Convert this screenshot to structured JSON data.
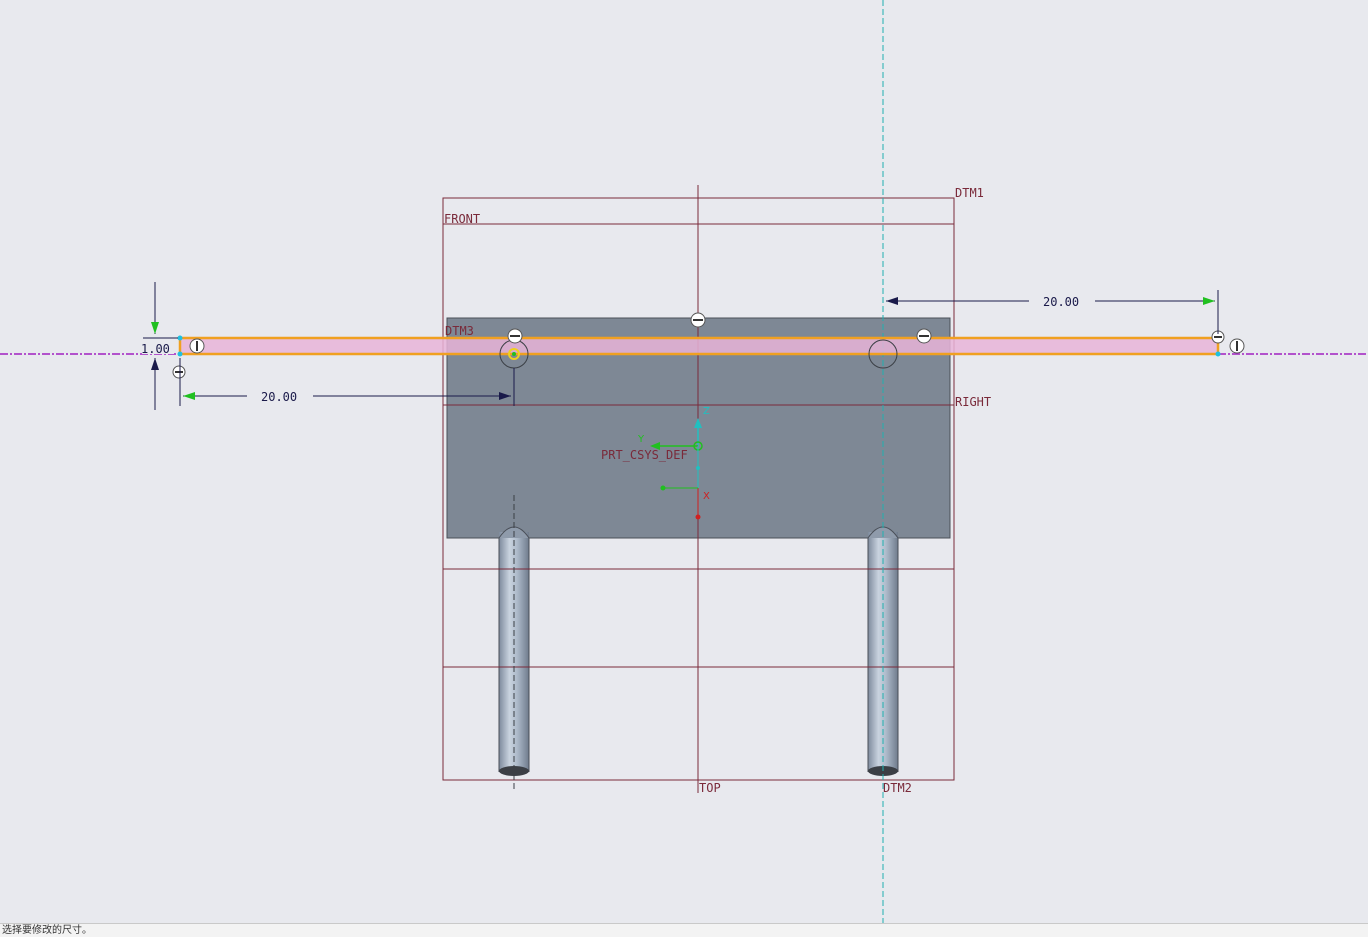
{
  "datum_planes": {
    "front": "FRONT",
    "right": "RIGHT",
    "top": "TOP",
    "dtm1": "DTM1",
    "dtm2": "DTM2",
    "dtm3": "DTM3"
  },
  "csys": {
    "name": "PRT_CSYS_DEF",
    "axis_x": "X",
    "axis_y": "Y",
    "axis_z": "Z"
  },
  "dimensions": {
    "height": "1.00",
    "left_distance": "20.00",
    "right_distance": "20.00"
  },
  "status_bar": {
    "message": "选择要修改的尺寸。"
  },
  "colors": {
    "background": "#e8e9ee",
    "datum_plane": "#7a2a3a",
    "sketch_highlight": "#f0a020",
    "sketch_fill": "#e8b4d8",
    "axis_line": "#a020c0",
    "solid_body": "#7e8895",
    "dimension": "#1a1a4a",
    "arrow_green": "#20c020",
    "csys_axis": "#20c0c0"
  }
}
